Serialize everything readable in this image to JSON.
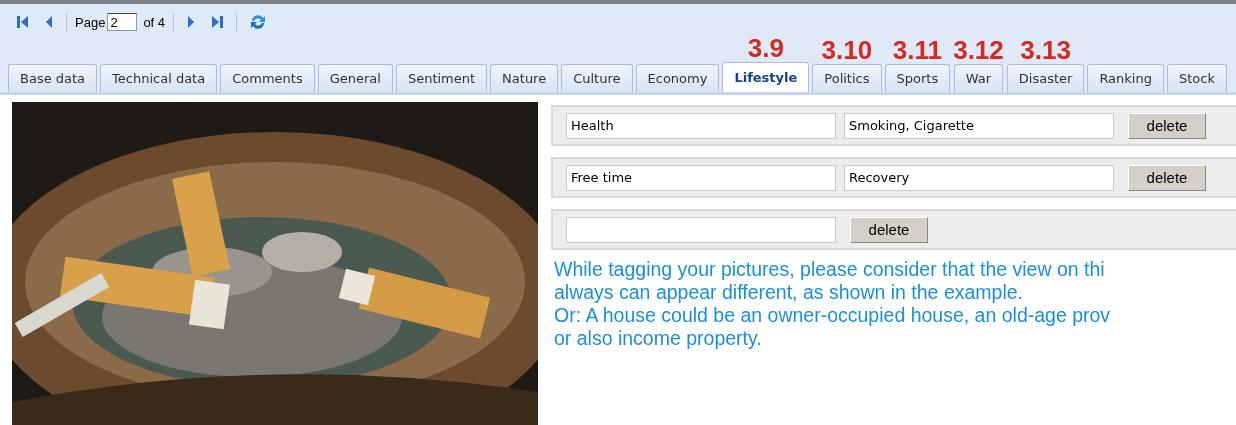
{
  "pager": {
    "page_label": "Page",
    "page": "2",
    "of_label": "of 4"
  },
  "tabs": [
    {
      "label": "Base data",
      "selected": false
    },
    {
      "label": "Technical data",
      "selected": false
    },
    {
      "label": "Comments",
      "selected": false
    },
    {
      "label": "General",
      "selected": false
    },
    {
      "label": "Sentiment",
      "selected": false
    },
    {
      "label": "Nature",
      "selected": false
    },
    {
      "label": "Culture",
      "selected": false
    },
    {
      "label": "Economy",
      "selected": false
    },
    {
      "label": "Lifestyle",
      "selected": true,
      "annotation": "3.9"
    },
    {
      "label": "Politics",
      "selected": false,
      "annotation": "3.10"
    },
    {
      "label": "Sports",
      "selected": false,
      "annotation": "3.11"
    },
    {
      "label": "War",
      "selected": false,
      "annotation": "3.12"
    },
    {
      "label": "Disaster",
      "selected": false,
      "annotation": "3.13"
    },
    {
      "label": "Ranking",
      "selected": false
    },
    {
      "label": "Stock",
      "selected": false
    }
  ],
  "tag_rows": [
    {
      "category": "Health",
      "tags": "Smoking, Cigarette",
      "button": "delete"
    },
    {
      "category": "Free time",
      "tags": "Recovery",
      "button": "delete"
    },
    {
      "category": "",
      "button": "delete"
    }
  ],
  "hint_lines": [
    "While tagging your pictures, please consider that the view on thi",
    "always can appear different, as shown in the example.",
    "Or: A house could be an owner-occupied house, an old-age prov",
    "or also income property."
  ]
}
